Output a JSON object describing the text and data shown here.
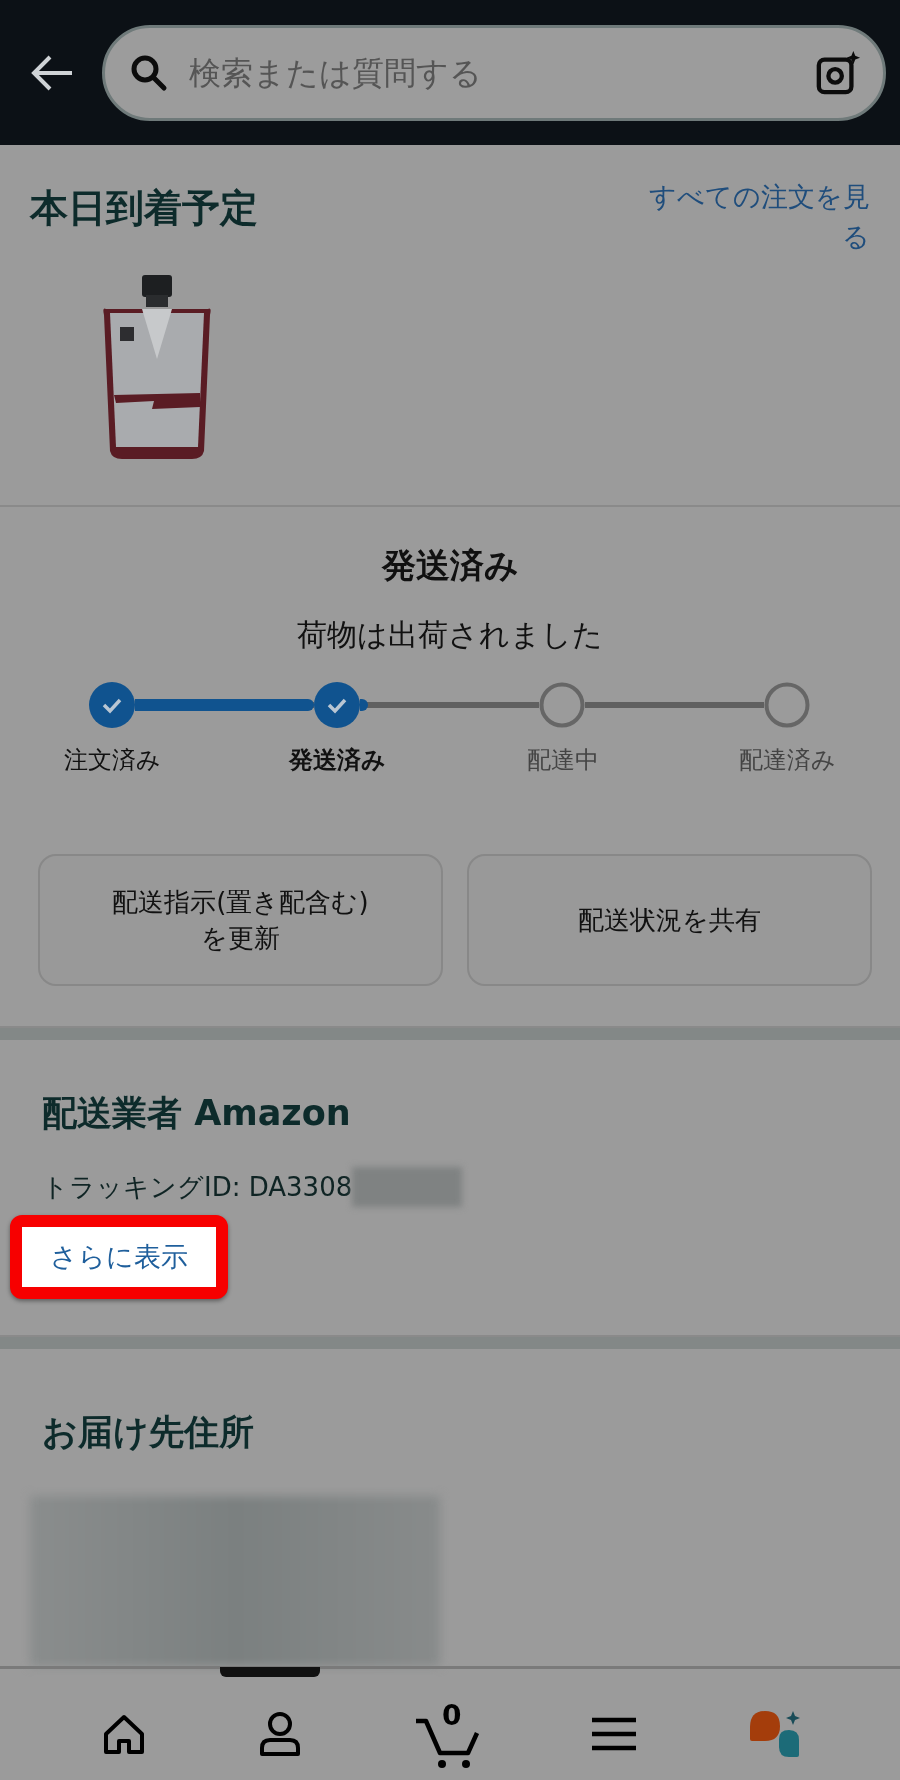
{
  "search": {
    "placeholder": "検索または質問する"
  },
  "arrival": {
    "title": "本日到着予定",
    "link": "すべての注文を見る"
  },
  "shipment": {
    "title": "発送済み",
    "subtitle": "荷物は出荷されました",
    "steps": [
      {
        "label": "注文済み",
        "completed": true,
        "selected": false
      },
      {
        "label": "発送済み",
        "completed": true,
        "selected": true
      },
      {
        "label": "配達中",
        "completed": false,
        "selected": false
      },
      {
        "label": "配達済み",
        "completed": false,
        "selected": false
      }
    ],
    "buttons": [
      "配送指示(置き配含む)\nを更新",
      "配送状況を共有"
    ]
  },
  "carrier": {
    "title": "配送業者 Amazon",
    "tracking": "トラッキングID: DA3308",
    "more_link": "さらに表示",
    "highlighted": true
  },
  "address": {
    "title": "お届け先住所"
  },
  "bottom_nav": {
    "cart_count": "0"
  }
}
